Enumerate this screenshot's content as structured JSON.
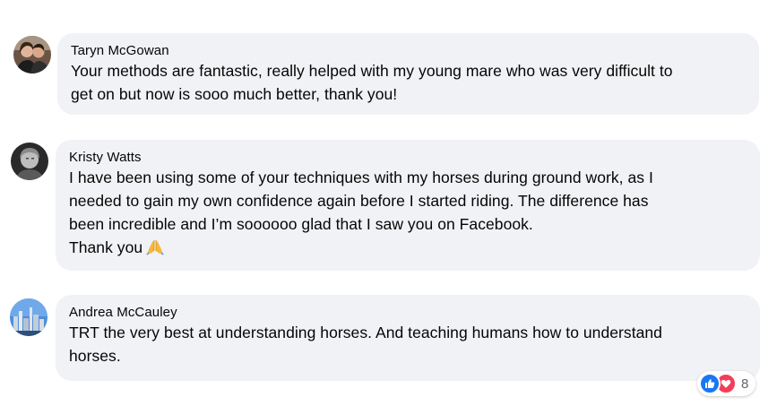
{
  "comments": [
    {
      "author": "Taryn McGowan",
      "text": "Your methods are fantastic, really helped with my young mare who was very difficult to\nget on but now is sooo much better, thank you!",
      "avatar_icon": "avatar-couple-photo"
    },
    {
      "author": "Kristy Watts",
      "text": "I have been using some of your techniques with my horses during ground work, as I\nneeded to gain my own confidence again before I started riding. The difference has\nbeen incredible and I’m soooooo glad that I saw you on Facebook.\nThank you",
      "emoji": "folded-hands-emoji",
      "avatar_icon": "avatar-bw-portrait"
    },
    {
      "author": "Andrea McCauley",
      "text": "TRT the very best at understanding horses. And teaching humans how to understand\nhorses.",
      "avatar_icon": "avatar-city-photo"
    }
  ],
  "reactions": {
    "types": [
      "like-icon",
      "love-icon"
    ],
    "count": "8",
    "like_color": "#1877f2",
    "love_color": "#f33e58"
  },
  "colors": {
    "bubble": "#f0f2f5",
    "text": "#050505"
  }
}
